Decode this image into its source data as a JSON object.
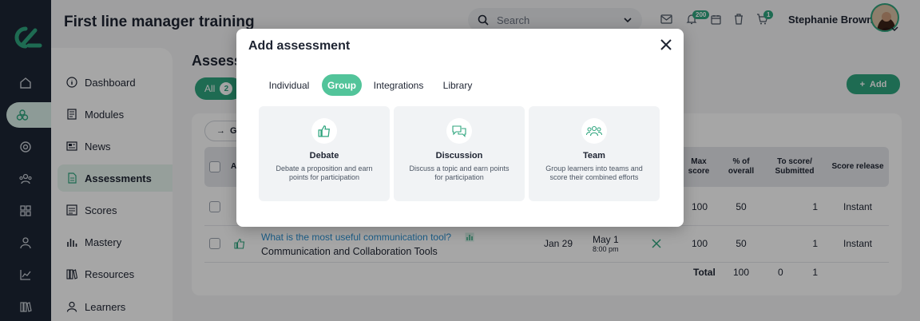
{
  "header": {
    "title": "First line manager training",
    "search_placeholder": "Search",
    "notifications_count": "200",
    "cart_count": "1",
    "user_name": "Stephanie Brown"
  },
  "sidebar": {
    "items": [
      {
        "label": "Dashboard",
        "icon": "info-icon"
      },
      {
        "label": "Modules",
        "icon": "book-icon"
      },
      {
        "label": "News",
        "icon": "news-icon"
      },
      {
        "label": "Assessments",
        "icon": "document-icon"
      },
      {
        "label": "Scores",
        "icon": "list-icon"
      },
      {
        "label": "Mastery",
        "icon": "bars-icon"
      },
      {
        "label": "Resources",
        "icon": "library-icon"
      },
      {
        "label": "Learners",
        "icon": "person-icon"
      }
    ],
    "active": "Assessments"
  },
  "main": {
    "title": "Assess",
    "filter_all": "All",
    "filter_count": "2",
    "add_label": "Add",
    "back_label": "G",
    "table": {
      "headers": {
        "a": "A",
        "max_score": "Max score",
        "pct_overall": "% of overall",
        "to_score": "To score/ Submitted",
        "release": "Score release"
      },
      "rows": [
        {
          "title": "",
          "subtitle": "",
          "date": "",
          "due": "",
          "due_time": "",
          "max": "100",
          "pct": "50",
          "to_score": "",
          "submitted": "1",
          "release": "Instant"
        },
        {
          "title": "What is the most useful communication tool?",
          "subtitle": "Communication and Collaboration Tools",
          "date": "Jan 29",
          "due": "May 1",
          "due_time": "8:00 pm",
          "max": "100",
          "pct": "50",
          "to_score": "",
          "submitted": "1",
          "release": "Instant"
        }
      ],
      "total_label": "Total",
      "total_max": "100",
      "total_to_score": "0",
      "total_submitted": "1"
    }
  },
  "modal": {
    "title": "Add assessment",
    "tabs": [
      "Individual",
      "Group",
      "Integrations",
      "Library"
    ],
    "active_tab": "Group",
    "cards": [
      {
        "title": "Debate",
        "description": "Debate a proposition and earn points for participation",
        "icon": "thumbs-up-icon"
      },
      {
        "title": "Discussion",
        "description": "Discuss a topic and earn points for participation",
        "icon": "chat-bubbles-icon"
      },
      {
        "title": "Team",
        "description": "Group learners into teams and score their combined efforts",
        "icon": "team-icon"
      }
    ]
  },
  "colors": {
    "accent": "#2fa57e",
    "accent_light": "#52c49a",
    "rail": "#1d2635",
    "link": "#2a8fd0"
  }
}
